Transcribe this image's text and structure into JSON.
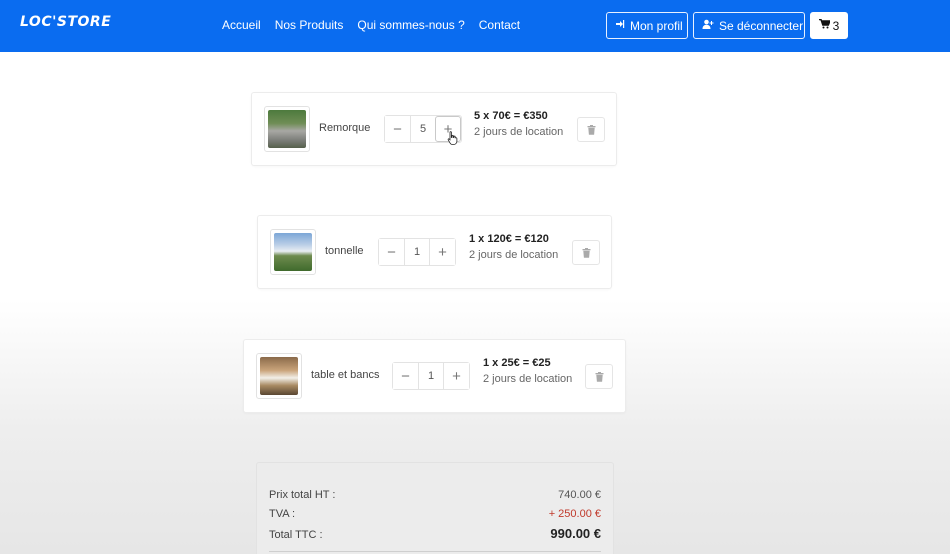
{
  "navbar": {
    "brand": "LOC'STORE",
    "links": [
      "Accueil",
      "Nos Produits",
      "Qui sommes-nous ?",
      "Contact"
    ],
    "profile_label": "Mon profil",
    "logout_label": "Se déconnecter",
    "cart_count": "3",
    "colors": {
      "background": "#0a6cf0",
      "text": "#ffffff"
    }
  },
  "cart": {
    "items": [
      {
        "name": "Remorque",
        "quantity": "5",
        "calc": "5 x 70€ = €350",
        "duration": "2 jours de location",
        "image_icon": "trailer-photo"
      },
      {
        "name": "tonnelle",
        "quantity": "1",
        "calc": "1 x 120€ = €120",
        "duration": "2 jours de location",
        "image_icon": "tent-photo"
      },
      {
        "name": "table et bancs",
        "quantity": "1",
        "calc": "1 x 25€ = €25",
        "duration": "2 jours de location",
        "image_icon": "table-photo"
      }
    ],
    "stepper_minus": "−",
    "stepper_plus": "+"
  },
  "totals": {
    "ht_label": "Prix total HT :",
    "ht_value": "740.00 €",
    "tva_label": "TVA :",
    "tva_value": "+ 250.00 €",
    "ttc_label": "Total TTC :",
    "ttc_value": "990.00 €",
    "colors": {
      "tva": "#c0392b"
    }
  }
}
